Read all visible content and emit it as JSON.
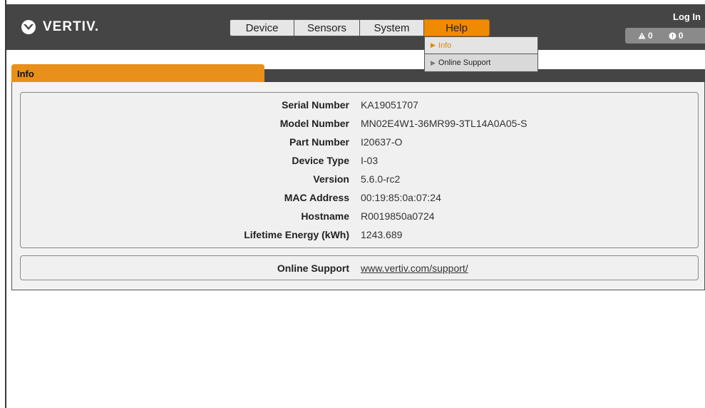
{
  "header": {
    "brand": "VERTIV.",
    "login_label": "Log In",
    "alarms": {
      "warning_count": "0",
      "critical_count": "0"
    },
    "nav": [
      {
        "label": "Device"
      },
      {
        "label": "Sensors"
      },
      {
        "label": "System"
      },
      {
        "label": "Help",
        "active": true
      }
    ],
    "help_menu": [
      {
        "label": "Info",
        "active": true
      },
      {
        "label": "Online Support"
      }
    ]
  },
  "panel": {
    "title": "Info",
    "details": [
      {
        "label": "Serial Number",
        "value": "KA19051707"
      },
      {
        "label": "Model Number",
        "value": "MN02E4W1-36MR99-3TL14A0A05-S"
      },
      {
        "label": "Part Number",
        "value": "I20637-O"
      },
      {
        "label": "Device Type",
        "value": "I-03"
      },
      {
        "label": "Version",
        "value": "5.6.0-rc2"
      },
      {
        "label": "MAC Address",
        "value": "00:19:85:0a:07:24"
      },
      {
        "label": "Hostname",
        "value": "R0019850a0724"
      },
      {
        "label": "Lifetime Energy (kWh)",
        "value": "1243.689"
      }
    ],
    "support": {
      "label": "Online Support",
      "link": "www.vertiv.com/support/"
    }
  },
  "colors": {
    "accent": "#f08a00",
    "header_bg": "#454545",
    "panel_bg": "#f2f2f2"
  }
}
